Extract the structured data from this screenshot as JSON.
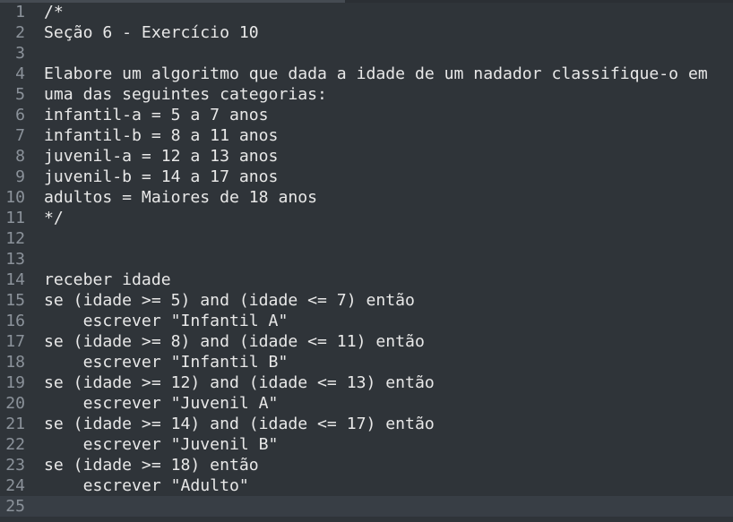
{
  "editor": {
    "lines": [
      {
        "number": "1",
        "text": "/*"
      },
      {
        "number": "2",
        "text": "Seção 6 - Exercício 10"
      },
      {
        "number": "3",
        "text": ""
      },
      {
        "number": "4",
        "text": "Elabore um algoritmo que dada a idade de um nadador classifique-o em"
      },
      {
        "number": "5",
        "text": "uma das seguintes categorias:"
      },
      {
        "number": "6",
        "text": "infantil-a = 5 a 7 anos"
      },
      {
        "number": "7",
        "text": "infantil-b = 8 a 11 anos"
      },
      {
        "number": "8",
        "text": "juvenil-a = 12 a 13 anos"
      },
      {
        "number": "9",
        "text": "juvenil-b = 14 a 17 anos"
      },
      {
        "number": "10",
        "text": "adultos = Maiores de 18 anos"
      },
      {
        "number": "11",
        "text": "*/"
      },
      {
        "number": "12",
        "text": ""
      },
      {
        "number": "13",
        "text": ""
      },
      {
        "number": "14",
        "text": "receber idade"
      },
      {
        "number": "15",
        "text": "se (idade >= 5) and (idade <= 7) então"
      },
      {
        "number": "16",
        "text": "    escrever \"Infantil A\""
      },
      {
        "number": "17",
        "text": "se (idade >= 8) and (idade <= 11) então"
      },
      {
        "number": "18",
        "text": "    escrever \"Infantil B\""
      },
      {
        "number": "19",
        "text": "se (idade >= 12) and (idade <= 13) então"
      },
      {
        "number": "20",
        "text": "    escrever \"Juvenil A\""
      },
      {
        "number": "21",
        "text": "se (idade >= 14) and (idade <= 17) então"
      },
      {
        "number": "22",
        "text": "    escrever \"Juvenil B\""
      },
      {
        "number": "23",
        "text": "se (idade >= 18) então"
      },
      {
        "number": "24",
        "text": "    escrever \"Adulto\""
      },
      {
        "number": "25",
        "text": ""
      }
    ]
  },
  "colors": {
    "background": "#2f3439",
    "current_line": "#383e45",
    "gutter_text": "#8b929a",
    "code_text": "#e8e8e8"
  }
}
